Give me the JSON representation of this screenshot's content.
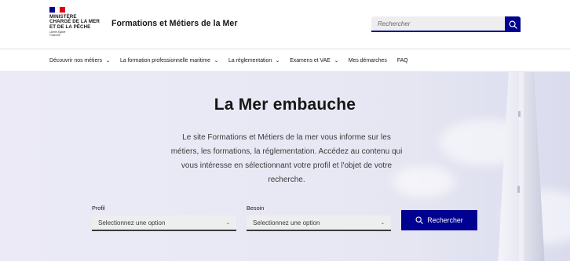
{
  "header": {
    "logo_lines": [
      "Ministère",
      "chargé de la mer",
      "et de la pêche"
    ],
    "logo_devise": "Liberté Égalité Fraternité",
    "site_title": "Formations et Métiers de la Mer",
    "search_placeholder": "Rechercher",
    "colors": {
      "brand_blue": "#000091",
      "flag_red": "#e1000f"
    },
    "search_icon": "search-icon"
  },
  "nav": {
    "items": [
      {
        "label": "Découvrir nos métiers",
        "has_dropdown": true
      },
      {
        "label": "La formation professionnelle maritime",
        "has_dropdown": true
      },
      {
        "label": "La réglementation",
        "has_dropdown": true
      },
      {
        "label": "Examens et VAE",
        "has_dropdown": true
      },
      {
        "label": "Mes démarches",
        "has_dropdown": false
      },
      {
        "label": "FAQ",
        "has_dropdown": false
      }
    ]
  },
  "hero": {
    "title": "La Mer embauche",
    "text": "Le site Formations et Métiers de la mer vous informe sur les métiers, les formations, la réglementation. Accédez au contenu qui vous intéresse en sélectionnant votre profil et l'objet de votre recherche.",
    "profil_label": "Profil",
    "profil_value": "Selectionnez une option",
    "besoin_label": "Besoin",
    "besoin_value": "Selectionnez une option",
    "search_button": "Rechercher"
  }
}
